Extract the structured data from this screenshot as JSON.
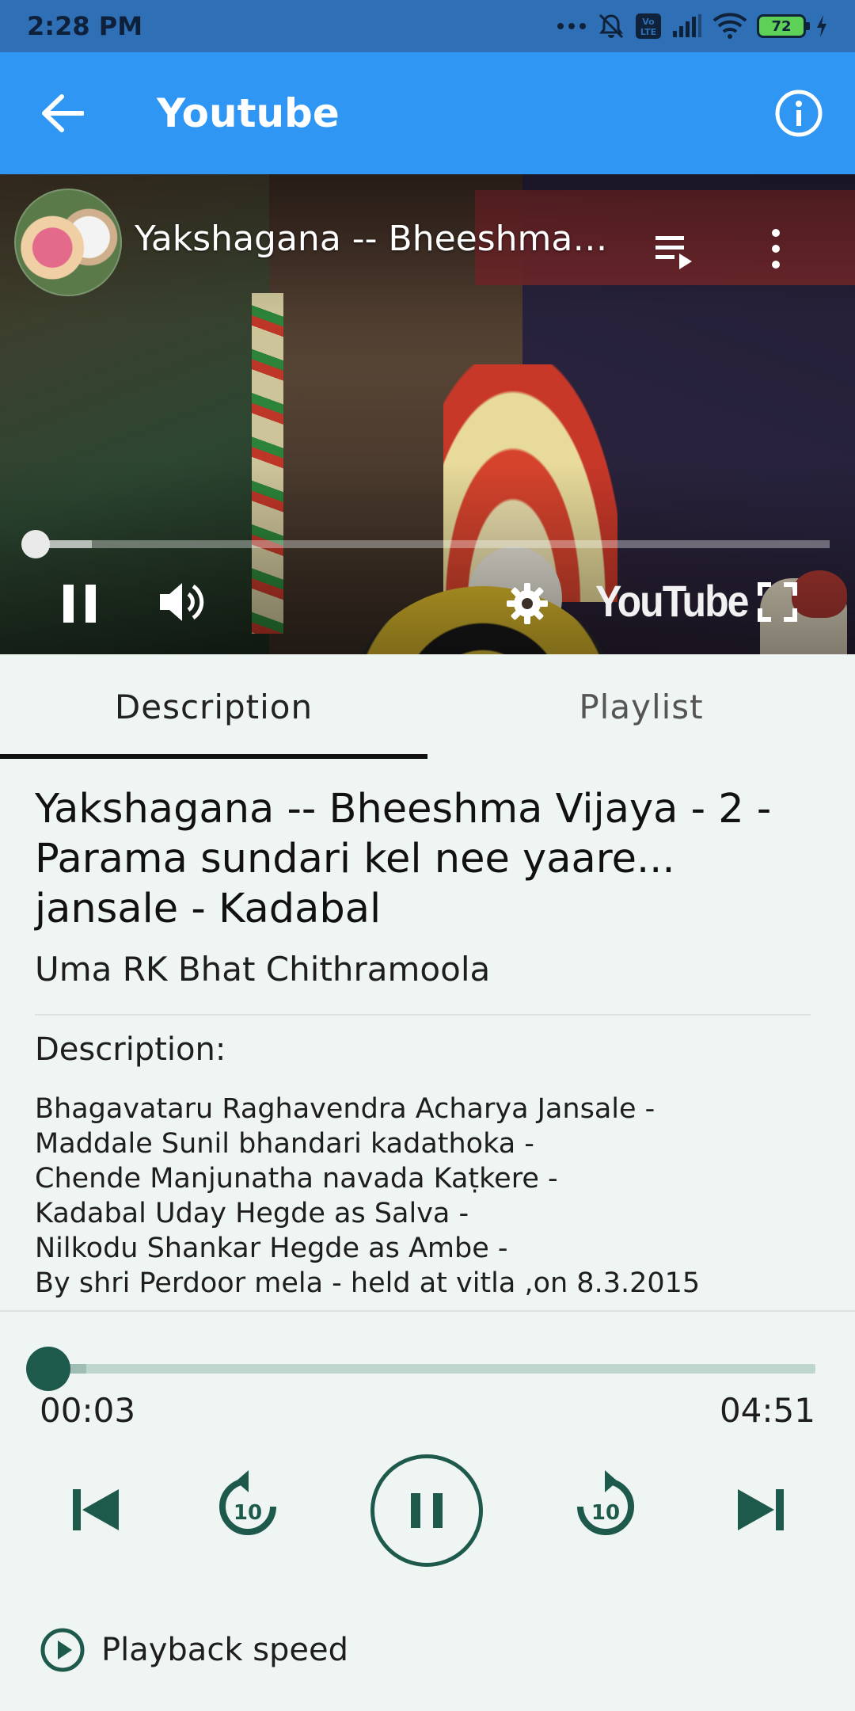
{
  "status_bar": {
    "time": "2:28 PM",
    "battery": "72",
    "volte": "Vo LTE"
  },
  "app_bar": {
    "title": "Youtube",
    "background": "#2f96f3"
  },
  "video": {
    "title": "Yakshagana -- Bheeshma ...",
    "logo_text": "YouTube",
    "progress_fraction": 0.01,
    "buffer_fraction": 0.07
  },
  "tabs": [
    {
      "label": "Description",
      "selected": true
    },
    {
      "label": "Playlist",
      "selected": false
    }
  ],
  "details": {
    "title": "Yakshagana -- Bheeshma Vijaya - 2 - Parama sundari kel nee yaare... jansale - Kadabal",
    "channel": "Uma RK Bhat Chithramoola",
    "description_label": "Description:",
    "description_lines": [
      "Bhagavataru Raghavendra Acharya Jansale -",
      "Maddale Sunil bhandari kadathoka -",
      "Chende Manjunatha navada Kaṭkere -",
      "Kadabal Uday Hegde as Salva -",
      "Nilkodu Shankar Hegde as Ambe -",
      "By shri Perdoor mela - held at vitla ,on 8.3.2015"
    ]
  },
  "player": {
    "current_time": "00:03",
    "total_time": "04:51",
    "progress_fraction": 0.01,
    "buffer_fraction": 0.05,
    "rewind_seconds": "10",
    "forward_seconds": "10",
    "playback_speed_label": "Playback speed",
    "accent": "#1e5a4b"
  }
}
